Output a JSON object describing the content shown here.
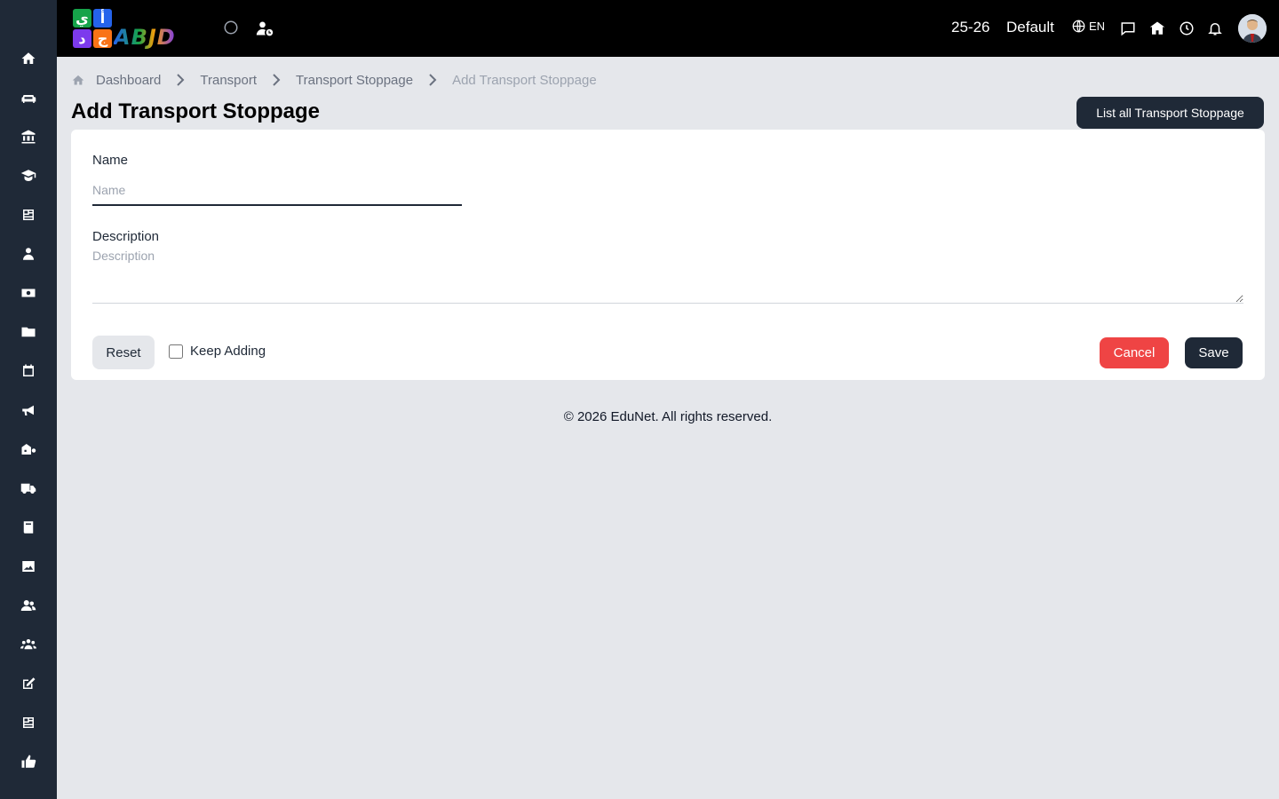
{
  "topbar": {
    "logo_letters": [
      "ي",
      "أ",
      "د",
      "ج"
    ],
    "logo_text": "ABJD",
    "session": "25-26",
    "profile": "Default",
    "language": "EN",
    "icons": [
      "circle-icon",
      "user-clock-icon",
      "globe-icon",
      "message-icon",
      "school-icon",
      "clock-icon",
      "bell-icon"
    ]
  },
  "sidebar": {
    "icons": [
      "home-icon",
      "sofa-icon",
      "bank-icon",
      "graduate-icon",
      "newspaper-icon",
      "teacher-icon",
      "money-icon",
      "folder-icon",
      "calendar-icon",
      "megaphone-icon",
      "hostel-icon",
      "truck-icon",
      "book-icon",
      "image-icon",
      "users-icon",
      "group-icon",
      "edit-icon",
      "news-icon",
      "thumbs-up-icon"
    ]
  },
  "breadcrumb": {
    "items": [
      "Dashboard",
      "Transport",
      "Transport Stoppage"
    ],
    "current": "Add Transport Stoppage"
  },
  "page": {
    "title": "Add Transport Stoppage",
    "list_button": "List all Transport Stoppage"
  },
  "form": {
    "name_label": "Name",
    "name_placeholder": "Name",
    "name_value": "",
    "description_label": "Description",
    "description_placeholder": "Description",
    "description_value": "",
    "reset_label": "Reset",
    "keep_adding_label": "Keep Adding",
    "keep_adding_checked": false,
    "cancel_label": "Cancel",
    "save_label": "Save"
  },
  "footer": {
    "text": "© 2026 EduNet. All rights reserved."
  },
  "colors": {
    "sidebar": "#1f2937",
    "topbar": "#000000",
    "background": "#e5e7eb",
    "primary_button": "#1f2937",
    "cancel_button": "#ef4444"
  }
}
